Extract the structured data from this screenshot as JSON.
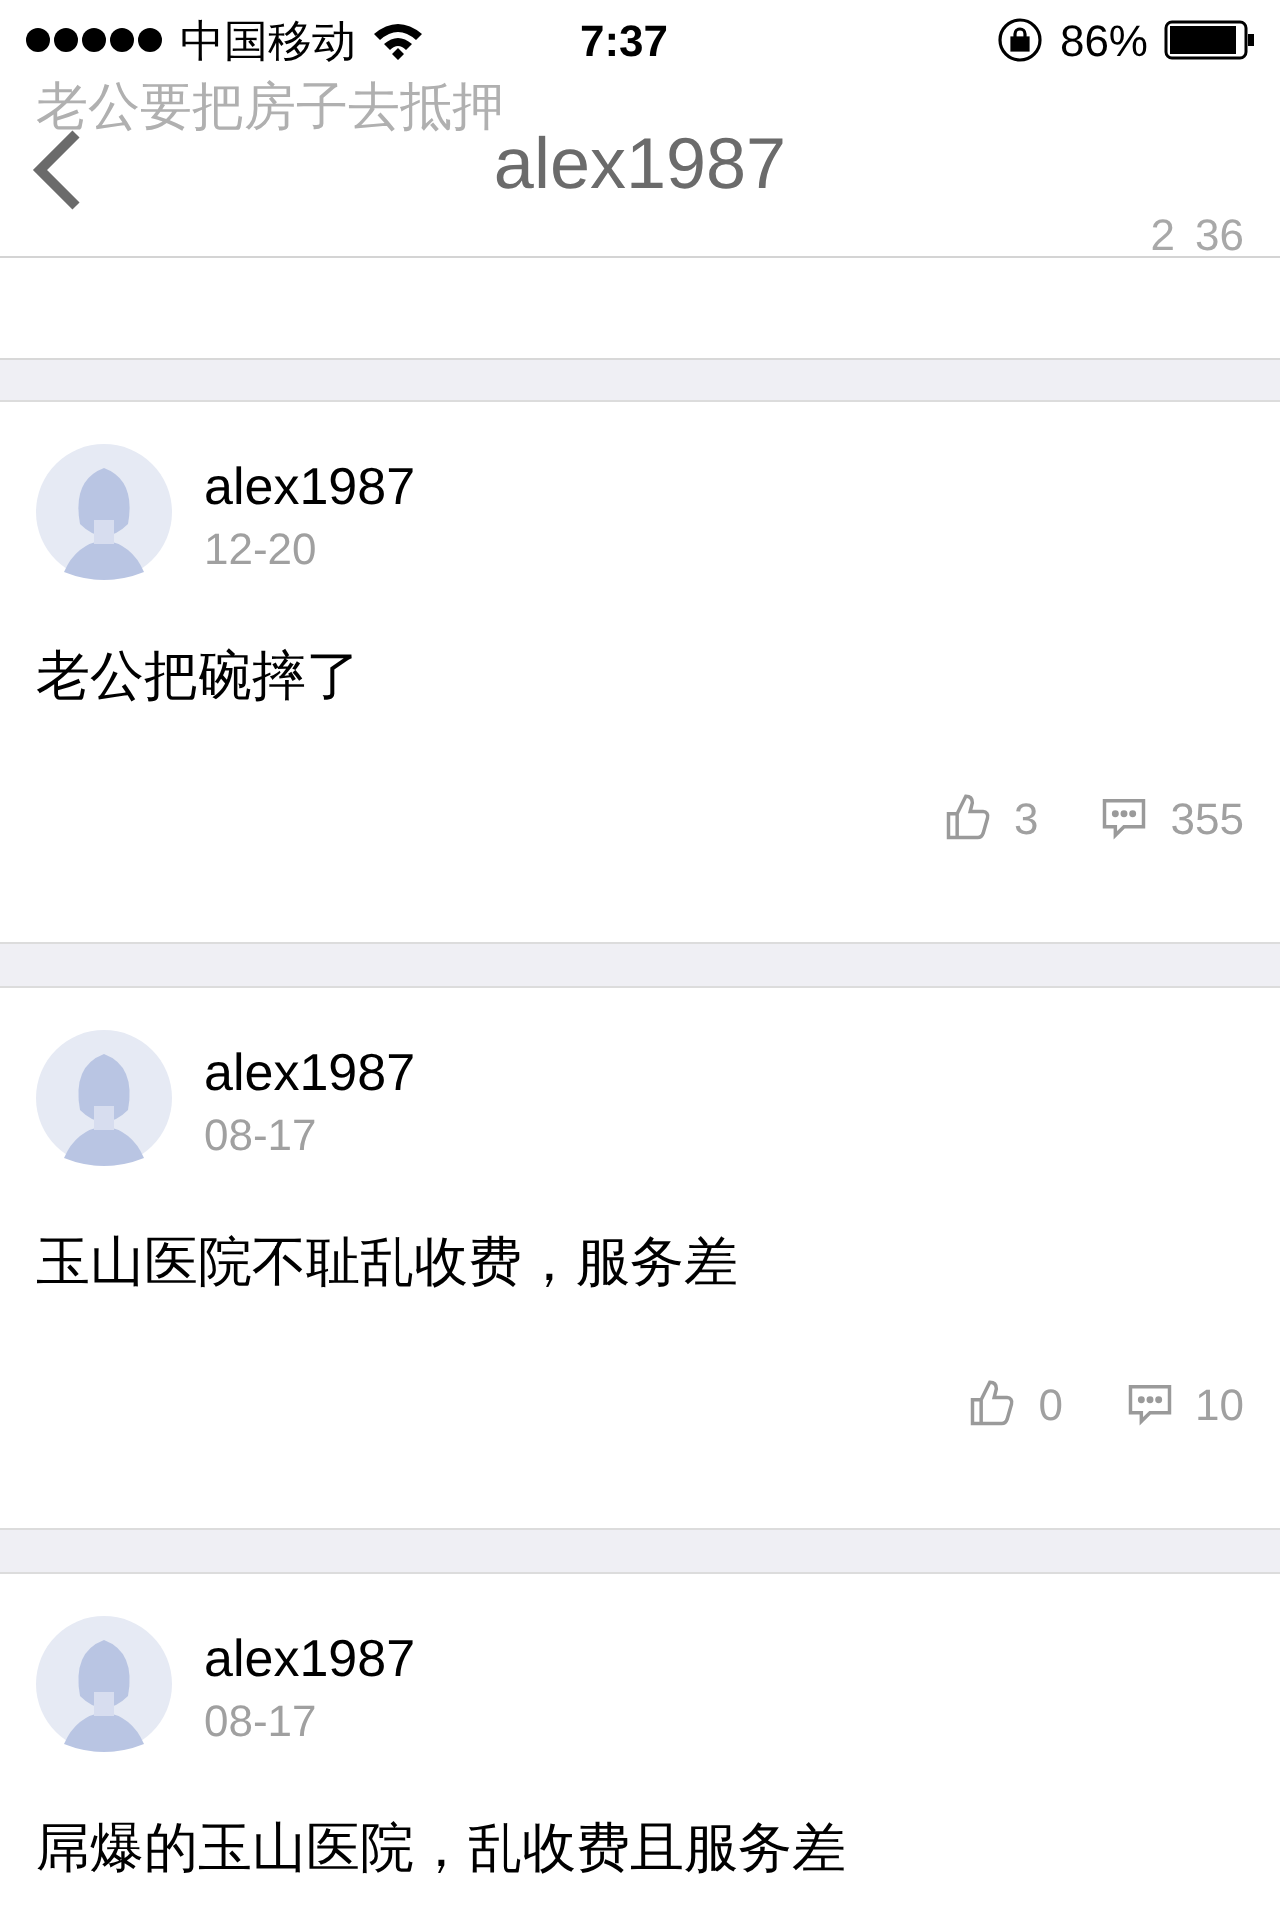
{
  "status_bar": {
    "carrier": "中国移动",
    "time": "7:37",
    "battery": "86%"
  },
  "nav": {
    "title": "alex1987"
  },
  "behind_nav": {
    "body": "老公要把房子去抵押",
    "likes": "2",
    "comments": "36"
  },
  "posts": [
    {
      "author": "alex1987",
      "date": "12-20",
      "body": "老公把碗摔了",
      "likes": "3",
      "comments": "355"
    },
    {
      "author": "alex1987",
      "date": "08-17",
      "body": "玉山医院不耻乱收费，服务差",
      "likes": "0",
      "comments": "10"
    },
    {
      "author": "alex1987",
      "date": "08-17",
      "body": "屌爆的玉山医院，乱收费且服务差"
    }
  ]
}
